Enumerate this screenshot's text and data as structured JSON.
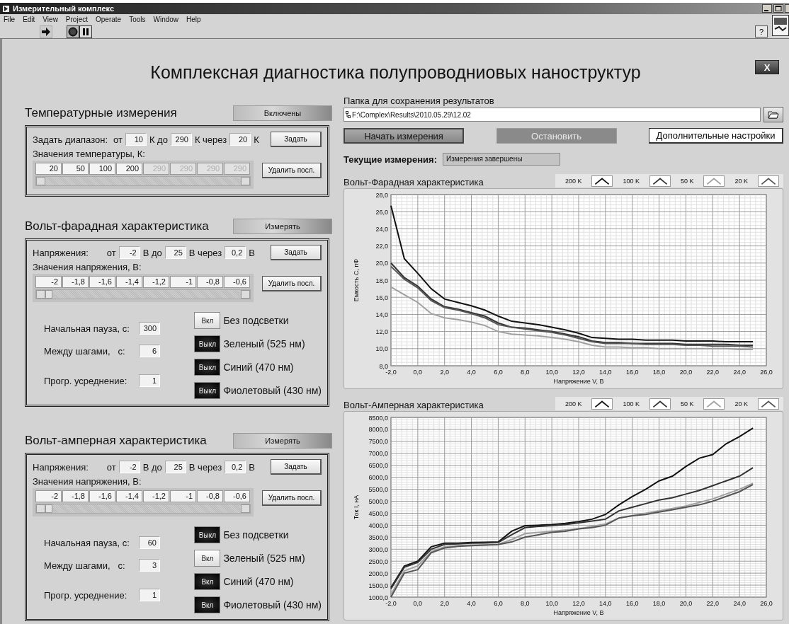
{
  "window": {
    "title": "Измерительный комплекс"
  },
  "menu": [
    "File",
    "Edit",
    "View",
    "Project",
    "Operate",
    "Tools",
    "Window",
    "Help"
  ],
  "toolbar": {
    "help": "?"
  },
  "title": "Комплексная диагностика полупроводниовых наноструктур",
  "close_button": "X",
  "temperature": {
    "heading": "Температурные измерения",
    "toggle": "Включены",
    "range": {
      "label": "Задать диапазон:",
      "from_label": "от",
      "from": "10",
      "to_label": "К до",
      "to": "290",
      "step_label": "К через",
      "step": "20",
      "unit": "К"
    },
    "set_button": "Задать",
    "values_label": "Значения температуры, К:",
    "values": [
      {
        "value": "20",
        "disabled": false
      },
      {
        "value": "50",
        "disabled": false
      },
      {
        "value": "100",
        "disabled": false
      },
      {
        "value": "200",
        "disabled": false
      },
      {
        "value": "290",
        "disabled": true
      },
      {
        "value": "290",
        "disabled": true
      },
      {
        "value": "290",
        "disabled": true
      },
      {
        "value": "290",
        "disabled": true
      }
    ],
    "delete_button": "Удалить посл."
  },
  "cv": {
    "heading": "Вольт-фарадная характеристика",
    "toggle": "Измерять",
    "range": {
      "label": "Напряжения:",
      "from_label": "от",
      "from": "-2",
      "to_label": "В до",
      "to": "25",
      "step_label": "В через",
      "step": "0,2",
      "unit": "В"
    },
    "set_button": "Задать",
    "values_label": "Значения напряжения, В:",
    "values": [
      "-2",
      "-1,8",
      "-1,6",
      "-1,4",
      "-1,2",
      "-1",
      "-0,8",
      "-0,6"
    ],
    "delete_button": "Удалить посл.",
    "params": [
      {
        "label": "Начальная пауза, с:",
        "value": "300"
      },
      {
        "label": "Между шагами,   с:",
        "value": "6"
      },
      {
        "label": "Прогр. усреднение:",
        "value": "1"
      }
    ],
    "lights": [
      {
        "button": "Вкл",
        "on": true,
        "label": "Без подсветки"
      },
      {
        "button": "Выкл",
        "on": false,
        "label": "Зеленый (525 нм)"
      },
      {
        "button": "Выкл",
        "on": false,
        "label": "Синий (470 нм)"
      },
      {
        "button": "Выкл",
        "on": false,
        "label": "Фиолетовый (430 нм)"
      }
    ]
  },
  "iv": {
    "heading": "Вольт-амперная характеристика",
    "toggle": "Измерять",
    "range": {
      "label": "Напряжения:",
      "from_label": "от",
      "from": "-2",
      "to_label": "В до",
      "to": "25",
      "step_label": "В через",
      "step": "0,2",
      "unit": "В"
    },
    "set_button": "Задать",
    "values_label": "Значения напряжения, В:",
    "values": [
      "-2",
      "-1,8",
      "-1,6",
      "-1,4",
      "-1,2",
      "-1",
      "-0,8",
      "-0,6"
    ],
    "delete_button": "Удалить посл.",
    "params": [
      {
        "label": "Начальная пауза, с:",
        "value": "60"
      },
      {
        "label": "Между шагами,   с:",
        "value": "3"
      },
      {
        "label": "Прогр. усреднение:",
        "value": "1"
      }
    ],
    "lights": [
      {
        "button": "Выкл",
        "on": false,
        "label": "Без подсветки"
      },
      {
        "button": "Вкл",
        "on": true,
        "label": "Зеленый (525 нм)"
      },
      {
        "button": "Вкл",
        "on": false,
        "label": "Синий (470 нм)"
      },
      {
        "button": "Вкл",
        "on": false,
        "label": "Фиолетовый (430 нм)"
      }
    ]
  },
  "save_folder": {
    "label": "Папка для сохранения результатов",
    "path": "F:\\Complex\\Results\\2010.05.29\\12.02"
  },
  "buttons": [
    {
      "label": "Начать измерения",
      "kind": "raised",
      "disabled": false
    },
    {
      "label": "Остановить",
      "kind": "raised",
      "disabled": true
    },
    {
      "label": "Дополнительные настройки",
      "kind": "flat",
      "disabled": false
    }
  ],
  "status": {
    "label": "Текущие измерения:",
    "value": "Измерения завершены"
  },
  "cv_chart": {
    "title": "Вольт-Фарадная характеристика",
    "chart_data": {
      "type": "line",
      "grid": true,
      "xlabel": "Напряжение V, В",
      "ylabel": "Емкость С, пФ",
      "x": [
        -2,
        -1,
        0,
        1,
        2,
        3,
        4,
        5,
        6,
        7,
        8,
        9,
        10,
        11,
        12,
        13,
        14,
        15,
        16,
        17,
        18,
        19,
        20,
        21,
        22,
        23,
        24,
        25
      ],
      "xlim": [
        -2,
        26
      ],
      "ylim": [
        8,
        28
      ],
      "xticks": [
        {
          "value": -2,
          "label": "-2,0"
        },
        {
          "value": 0,
          "label": "0,0"
        },
        {
          "value": 2,
          "label": "2,0"
        },
        {
          "value": 4,
          "label": "4,0"
        },
        {
          "value": 6,
          "label": "6,0"
        },
        {
          "value": 8,
          "label": "8,0"
        },
        {
          "value": 10,
          "label": "10,0"
        },
        {
          "value": 12,
          "label": "12,0"
        },
        {
          "value": 14,
          "label": "14,0"
        },
        {
          "value": 16,
          "label": "16,0"
        },
        {
          "value": 18,
          "label": "18,0"
        },
        {
          "value": 20,
          "label": "20,0"
        },
        {
          "value": 22,
          "label": "22,0"
        },
        {
          "value": 24,
          "label": "24,0"
        },
        {
          "value": 26,
          "label": "26,0"
        }
      ],
      "yticks": [
        {
          "value": 8,
          "label": "8,0"
        },
        {
          "value": 10,
          "label": "10,0"
        },
        {
          "value": 12,
          "label": "12,0"
        },
        {
          "value": 14,
          "label": "14,0"
        },
        {
          "value": 16,
          "label": "16,0"
        },
        {
          "value": 18,
          "label": "18,0"
        },
        {
          "value": 20,
          "label": "20,0"
        },
        {
          "value": 22,
          "label": "22,0"
        },
        {
          "value": 24,
          "label": "24,0"
        },
        {
          "value": 26,
          "label": "26,0"
        },
        {
          "value": 28,
          "label": "28,0"
        }
      ],
      "series": [
        {
          "name": "200 K",
          "color": "#111111",
          "values": [
            26.7,
            20.5,
            18.8,
            17.0,
            15.8,
            15.4,
            15.0,
            14.5,
            13.8,
            13.2,
            13.0,
            12.8,
            12.5,
            12.2,
            11.8,
            11.3,
            11.2,
            11.1,
            11.1,
            11.0,
            11.0,
            11.0,
            10.9,
            10.9,
            10.9,
            10.8,
            10.8,
            10.8
          ]
        },
        {
          "name": "100 K",
          "color": "#333333",
          "values": [
            20.0,
            18.3,
            17.3,
            15.8,
            14.9,
            14.6,
            14.2,
            13.8,
            13.0,
            12.5,
            12.4,
            12.2,
            12.0,
            11.7,
            11.4,
            10.9,
            10.7,
            10.7,
            10.6,
            10.6,
            10.6,
            10.6,
            10.5,
            10.5,
            10.5,
            10.5,
            10.4,
            10.4
          ]
        },
        {
          "name": "50 K",
          "color": "#a0a0a0",
          "values": [
            17.2,
            16.3,
            15.4,
            14.1,
            13.6,
            13.4,
            13.1,
            12.7,
            12.0,
            11.7,
            11.6,
            11.5,
            11.3,
            11.1,
            10.8,
            10.4,
            10.2,
            10.2,
            10.1,
            10.1,
            10.0,
            10.0,
            10.0,
            10.0,
            10.0,
            10.0,
            9.9,
            9.9
          ]
        },
        {
          "name": "20 K",
          "color": "#555555",
          "values": [
            19.6,
            18.1,
            17.1,
            15.6,
            14.8,
            14.5,
            14.1,
            13.6,
            12.8,
            12.5,
            12.3,
            12.1,
            11.9,
            11.6,
            11.2,
            10.8,
            10.6,
            10.6,
            10.6,
            10.5,
            10.5,
            10.5,
            10.4,
            10.4,
            10.3,
            10.3,
            10.3,
            10.2
          ]
        }
      ]
    }
  },
  "iv_chart": {
    "title": "Вольт-Амперная характеристика",
    "chart_data": {
      "type": "line",
      "grid": true,
      "xlabel": "Напряжение V, В",
      "ylabel": "Ток I, нА",
      "x": [
        -2,
        -1,
        0,
        1,
        2,
        3,
        4,
        5,
        6,
        7,
        8,
        9,
        10,
        11,
        12,
        13,
        14,
        15,
        16,
        17,
        18,
        19,
        20,
        21,
        22,
        23,
        24,
        25
      ],
      "xlim": [
        -2,
        26
      ],
      "ylim": [
        1000,
        8500
      ],
      "xticks": [
        {
          "value": -2,
          "label": "-2,0"
        },
        {
          "value": 0,
          "label": "0,0"
        },
        {
          "value": 2,
          "label": "2,0"
        },
        {
          "value": 4,
          "label": "4,0"
        },
        {
          "value": 6,
          "label": "6,0"
        },
        {
          "value": 8,
          "label": "8,0"
        },
        {
          "value": 10,
          "label": "10,0"
        },
        {
          "value": 12,
          "label": "12,0"
        },
        {
          "value": 14,
          "label": "14,0"
        },
        {
          "value": 16,
          "label": "16,0"
        },
        {
          "value": 18,
          "label": "18,0"
        },
        {
          "value": 20,
          "label": "20,0"
        },
        {
          "value": 22,
          "label": "22,0"
        },
        {
          "value": 24,
          "label": "24,0"
        },
        {
          "value": 26,
          "label": "26,0"
        }
      ],
      "yticks": [
        {
          "value": 1000,
          "label": "1000,0"
        },
        {
          "value": 1500,
          "label": "1500,0"
        },
        {
          "value": 2000,
          "label": "2000,0"
        },
        {
          "value": 2500,
          "label": "2500,0"
        },
        {
          "value": 3000,
          "label": "3000,0"
        },
        {
          "value": 3500,
          "label": "3500,0"
        },
        {
          "value": 4000,
          "label": "4000,0"
        },
        {
          "value": 4500,
          "label": "4500,0"
        },
        {
          "value": 5000,
          "label": "5000,0"
        },
        {
          "value": 5500,
          "label": "5500,0"
        },
        {
          "value": 6000,
          "label": "6000,0"
        },
        {
          "value": 6500,
          "label": "6500,0"
        },
        {
          "value": 7000,
          "label": "7000,0"
        },
        {
          "value": 7500,
          "label": "7500,0"
        },
        {
          "value": 8000,
          "label": "8000,0"
        },
        {
          "value": 8500,
          "label": "8500,0"
        }
      ],
      "series": [
        {
          "name": "200 K",
          "color": "#111111",
          "values": [
            1400,
            2300,
            2500,
            3100,
            3250,
            3250,
            3280,
            3290,
            3300,
            3750,
            3980,
            4000,
            4030,
            4080,
            4150,
            4250,
            4450,
            4850,
            5200,
            5500,
            5850,
            6050,
            6450,
            6800,
            6950,
            7400,
            7700,
            8050
          ]
        },
        {
          "name": "100 K",
          "color": "#333333",
          "values": [
            1350,
            2250,
            2450,
            3000,
            3200,
            3220,
            3250,
            3260,
            3280,
            3600,
            3900,
            3950,
            3980,
            4030,
            4100,
            4170,
            4250,
            4600,
            4750,
            4900,
            5050,
            5150,
            5300,
            5450,
            5650,
            5850,
            6050,
            6400
          ]
        },
        {
          "name": "50 K",
          "color": "#a0a0a0",
          "values": [
            1100,
            2100,
            2300,
            2900,
            3100,
            3150,
            3170,
            3180,
            3200,
            3400,
            3650,
            3700,
            3750,
            3800,
            3850,
            3950,
            4050,
            4300,
            4400,
            4500,
            4600,
            4700,
            4800,
            4950,
            5100,
            5300,
            5500,
            5750
          ]
        },
        {
          "name": "20 K",
          "color": "#555555",
          "values": [
            1000,
            2000,
            2150,
            2850,
            3050,
            3120,
            3150,
            3170,
            3190,
            3300,
            3500,
            3600,
            3700,
            3750,
            3850,
            3900,
            4000,
            4300,
            4400,
            4450,
            4550,
            4650,
            4750,
            4850,
            5000,
            5200,
            5400,
            5700
          ]
        }
      ]
    }
  }
}
